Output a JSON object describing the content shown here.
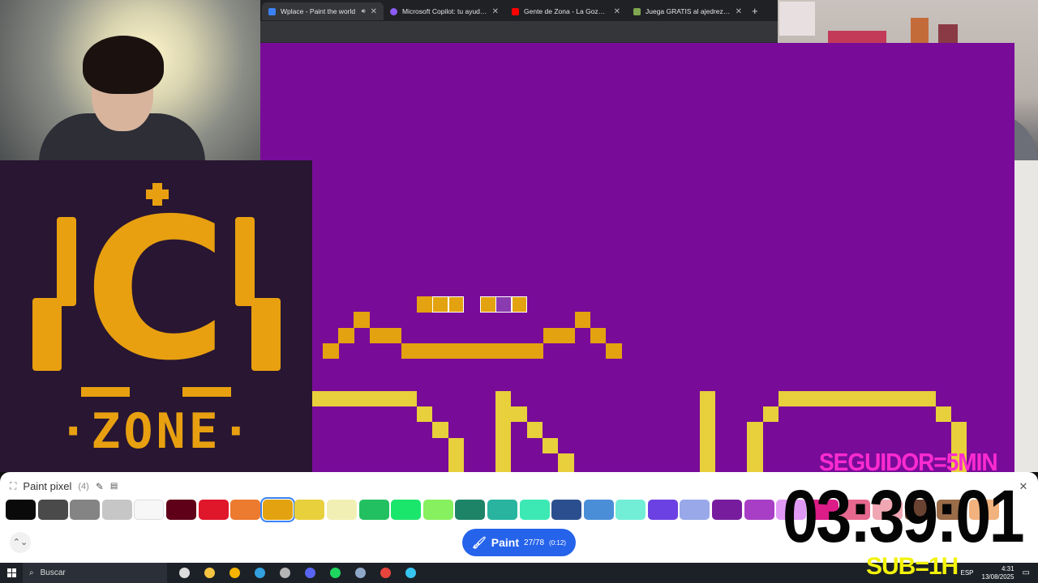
{
  "browser": {
    "tabs": [
      {
        "title": "Wplace - Paint the world",
        "favicon_color": "#3b82f6",
        "active": true,
        "audio": true
      },
      {
        "title": "Microsoft Copilot: tu ayudante",
        "favicon_color": "#8b5cf6",
        "active": false,
        "audio": false
      },
      {
        "title": "Gente de Zona - La Gozadera",
        "favicon_color": "#ff0000",
        "active": false,
        "audio": false
      },
      {
        "title": "Juega GRATIS al ajedrez online",
        "favicon_color": "#7fa650",
        "active": false,
        "audio": false
      }
    ],
    "new_tab_label": "+"
  },
  "canvas": {
    "background": "#780c99",
    "pixel_color": "#e3a20f",
    "alt_pixel_color": "#e8cf3c"
  },
  "logo": {
    "letter": "C",
    "word": "·ZONE·",
    "color": "#e8a010",
    "background": "#281632"
  },
  "paint_panel": {
    "title": "Paint pixel",
    "count": "(4)",
    "edit_icon": "pencil-icon",
    "eraser_icon": "eraser-icon",
    "close_label": "✕",
    "palette": [
      "#0a0a0a",
      "#4a4a4a",
      "#848484",
      "#c6c6c6",
      "#f7f7f7",
      "#600018",
      "#e0162b",
      "#ec7a2f",
      "#e3a20f",
      "#e8cf3c",
      "#f1efb3",
      "#23c061",
      "#1be66c",
      "#86f05e",
      "#1d8467",
      "#28b49f",
      "#3ce9b5",
      "#2b4f8e",
      "#4a8ed8",
      "#72eed7",
      "#6c41e3",
      "#99a8e8",
      "#781c9e",
      "#a83ec5",
      "#e09af5",
      "#dc1c87",
      "#e7688f",
      "#f0a7b3",
      "#6a4231",
      "#9b6c48",
      "#f1b27e"
    ],
    "selected_index": 8,
    "paint_button": {
      "label": "Paint",
      "progress": "27/78",
      "cooldown": "(0:12)",
      "icon": "brush-icon"
    },
    "expand_label": "⌃⌄"
  },
  "overlay": {
    "seguidor": "SEGUIDOR=5MIN",
    "timer": "03:39:01",
    "sub": "SUB=1H"
  },
  "taskbar": {
    "search_placeholder": "Buscar",
    "apps": [
      {
        "name": "task-view-icon",
        "color": "#dddddd"
      },
      {
        "name": "file-explorer-icon",
        "color": "#f5c542"
      },
      {
        "name": "chrome-icon",
        "color": "#f4b400"
      },
      {
        "name": "edge-icon",
        "color": "#33a0e0"
      },
      {
        "name": "obs-icon",
        "color": "#b5b5b5"
      },
      {
        "name": "discord-icon",
        "color": "#5865f2"
      },
      {
        "name": "spotify-icon",
        "color": "#1ed760"
      },
      {
        "name": "steam-icon",
        "color": "#8fa8c8"
      },
      {
        "name": "chrome-active-icon",
        "color": "#e8453c"
      },
      {
        "name": "app-icon",
        "color": "#36c5f0"
      }
    ],
    "language": "ESP",
    "time": "4:31",
    "date": "13/08/2025"
  }
}
